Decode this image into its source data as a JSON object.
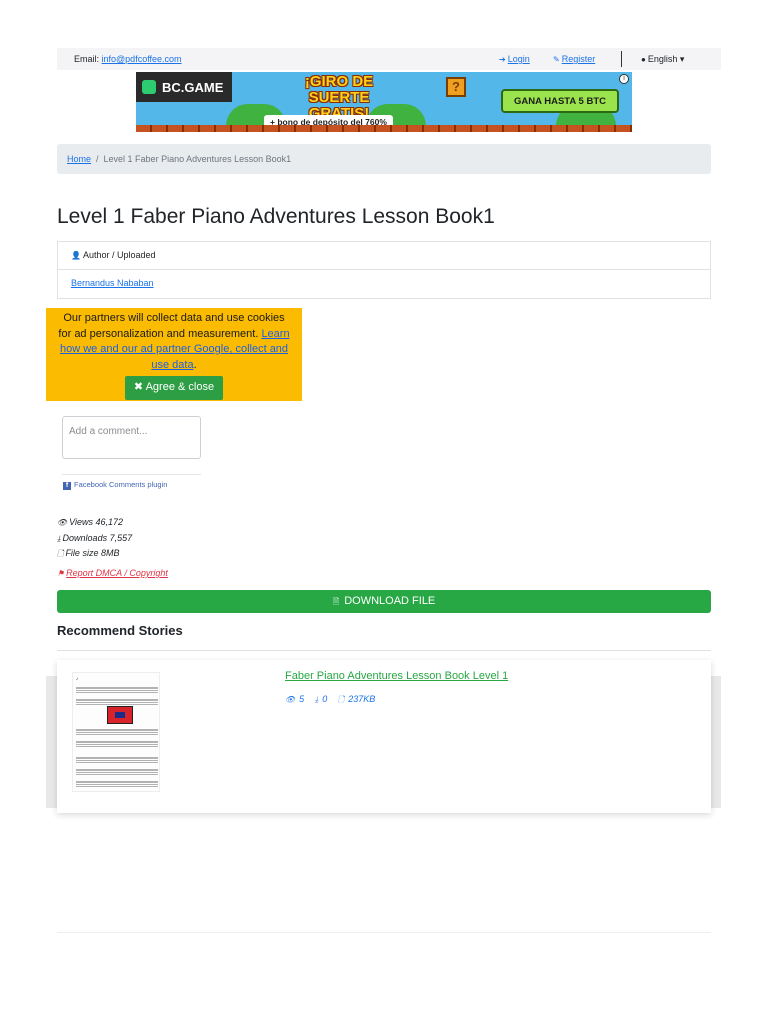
{
  "topbar": {
    "email_label": "Email:",
    "email_link": "info@pdfcoffee.com",
    "login": "Login",
    "register": "Register",
    "language": "English"
  },
  "banner": {
    "brand": "BC.GAME",
    "headline": "¡GIRO DE SUERTE GRATIS!",
    "bonus": "+ bono de depósito del 760%",
    "cta": "GANA HASTA 5 BTC",
    "block_glyph": "?"
  },
  "breadcrumb": {
    "home": "Home",
    "separator": "/",
    "current": "Level 1 Faber Piano Adventures Lesson Book1"
  },
  "page": {
    "title": "Level 1 Faber Piano Adventures Lesson Book1"
  },
  "author_card": {
    "header": "Author / Uploaded",
    "author": "Bernandus Nababan"
  },
  "consent": {
    "text": "Our partners will collect data and use cookies for ad personalization and measurement.",
    "link": "Learn how we and our ad partner Google, collect and use data",
    "suffix": ".",
    "button": "Agree & close"
  },
  "comments": {
    "placeholder": "Add a comment...",
    "plugin": "Facebook Comments plugin"
  },
  "stats": {
    "views": "Views 46,172",
    "downloads": "Downloads 7,557",
    "file_size": "File size 8MB",
    "report": "Report DMCA / Copyright"
  },
  "download": {
    "label": "DOWNLOAD FILE"
  },
  "recommend": {
    "heading": "Recommend Stories",
    "items": [
      {
        "title": "Faber Piano Adventures Lesson Book Level 1",
        "views": "5",
        "downloads": "0",
        "size": "237KB"
      }
    ]
  },
  "icons": {
    "login": "sign-in-icon",
    "register": "edit-icon",
    "language": "globe-icon",
    "author": "user-icon",
    "views": "eye-icon",
    "downloads": "download-icon",
    "file": "file-icon",
    "report": "flag-icon",
    "download_button": "pdf-file-icon"
  },
  "colors": {
    "link": "#1a73e8",
    "success": "#28a745",
    "danger": "#dc3545",
    "consent_bg": "#fbbb00",
    "breadcrumb_bg": "#e9ecef"
  }
}
